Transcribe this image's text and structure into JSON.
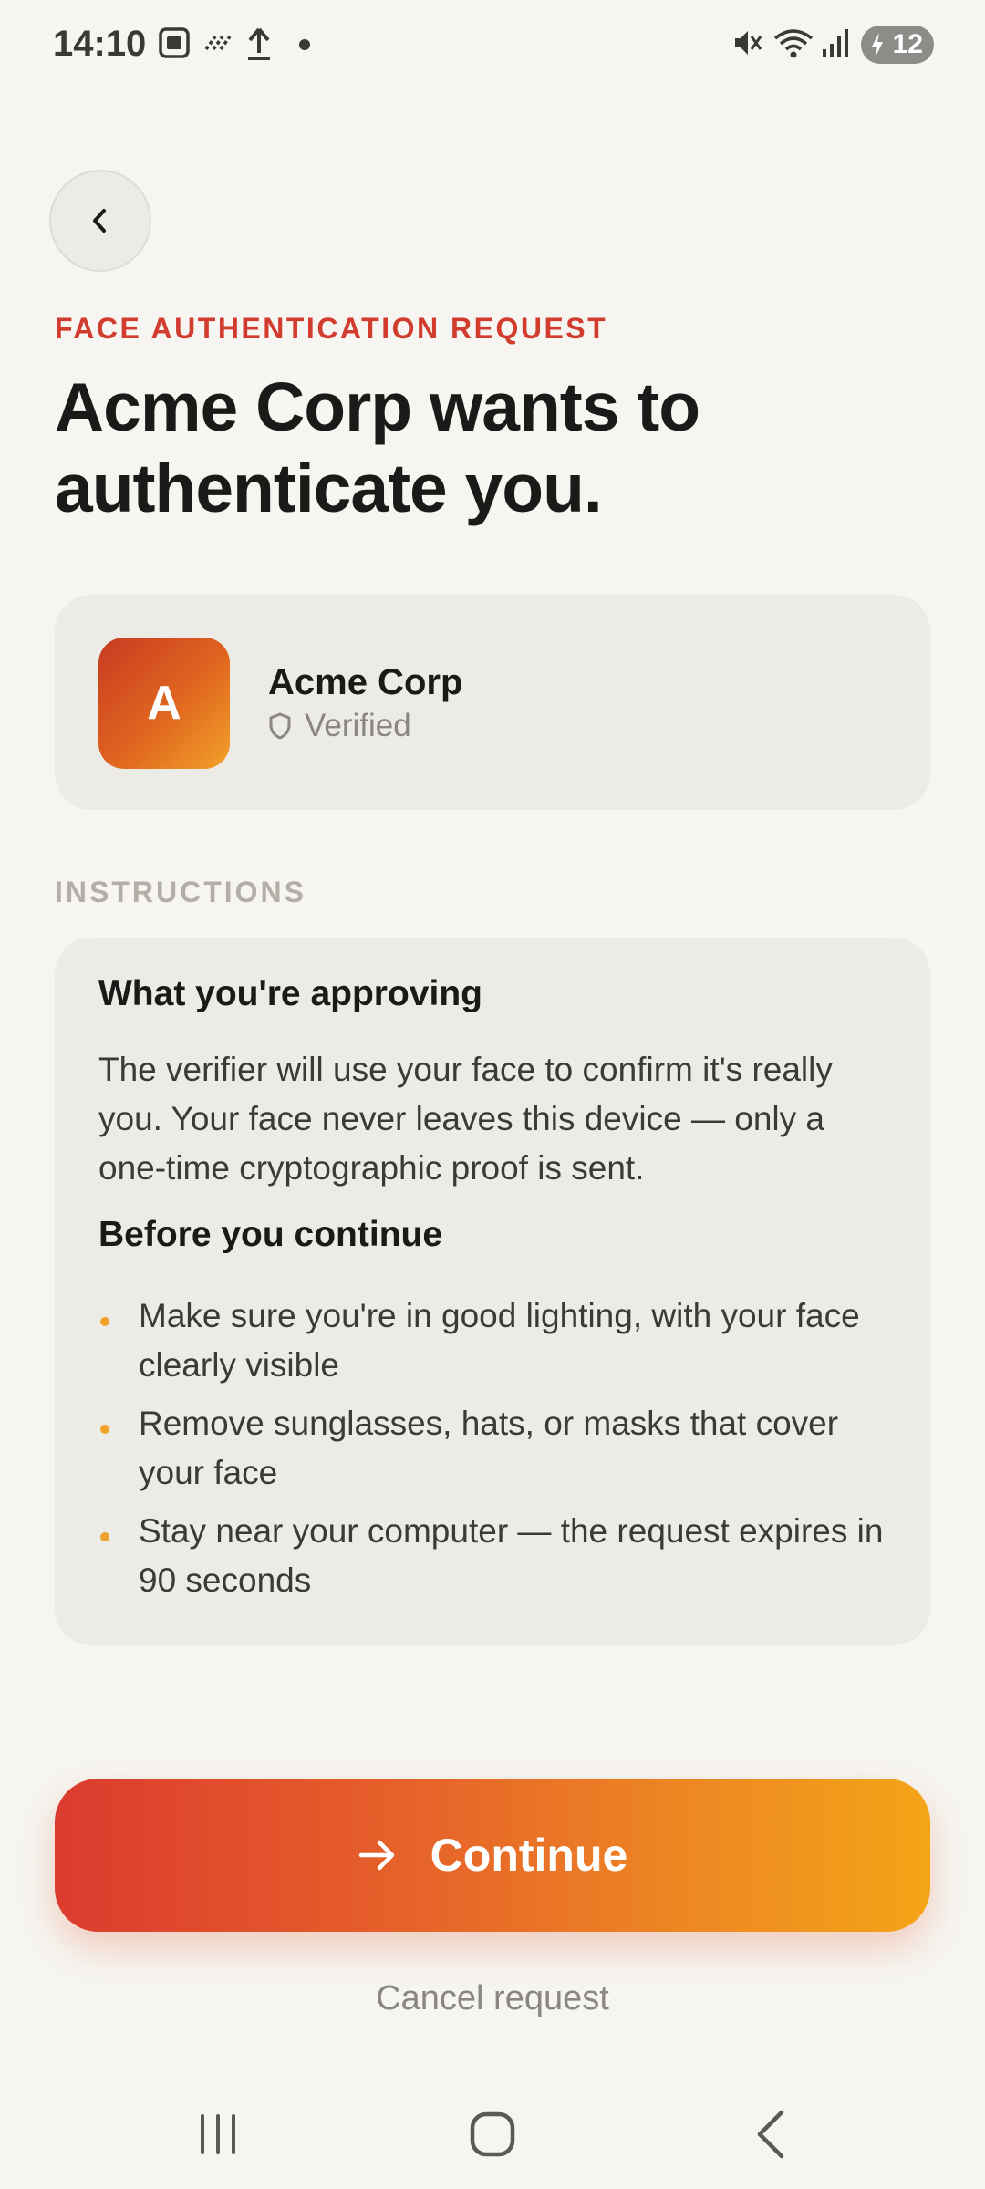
{
  "status_bar": {
    "time": "14:10",
    "battery_level": "12",
    "icons": [
      "screenshot-icon",
      "nfc-icon",
      "upload-icon",
      "dot-icon",
      "mute-icon",
      "wifi-icon",
      "signal-icon",
      "battery-charging-icon"
    ]
  },
  "header": {
    "back_icon": "chevron-left-icon",
    "eyebrow": "FACE AUTHENTICATION REQUEST",
    "title": "Acme Corp wants to authenticate you."
  },
  "requester": {
    "avatar_letter": "A",
    "name": "Acme Corp",
    "verified_label": "Verified",
    "verified_icon": "shield-icon"
  },
  "instructions": {
    "section_label": "INSTRUCTIONS",
    "approving_heading": "What you're approving",
    "approving_text": "The verifier will use your face to confirm it's really you. Your face never leaves this device — only a one-time cryptographic proof is sent.",
    "before_heading": "Before you continue",
    "bullets": [
      "Make sure you're in good lighting, with your face clearly visible",
      "Remove sunglasses, hats, or masks that cover your face",
      "Stay near your computer — the request expires in 90 seconds"
    ]
  },
  "actions": {
    "continue_label": "Continue",
    "continue_icon": "arrow-right-icon",
    "cancel_label": "Cancel request"
  },
  "nav_bar": {
    "buttons": [
      "recent-apps-icon",
      "home-icon",
      "back-icon"
    ]
  },
  "colors": {
    "accent_red": "#d13c2f",
    "accent_orange": "#f4a517",
    "background": "#f6f5f1",
    "card": "#edebe6"
  }
}
